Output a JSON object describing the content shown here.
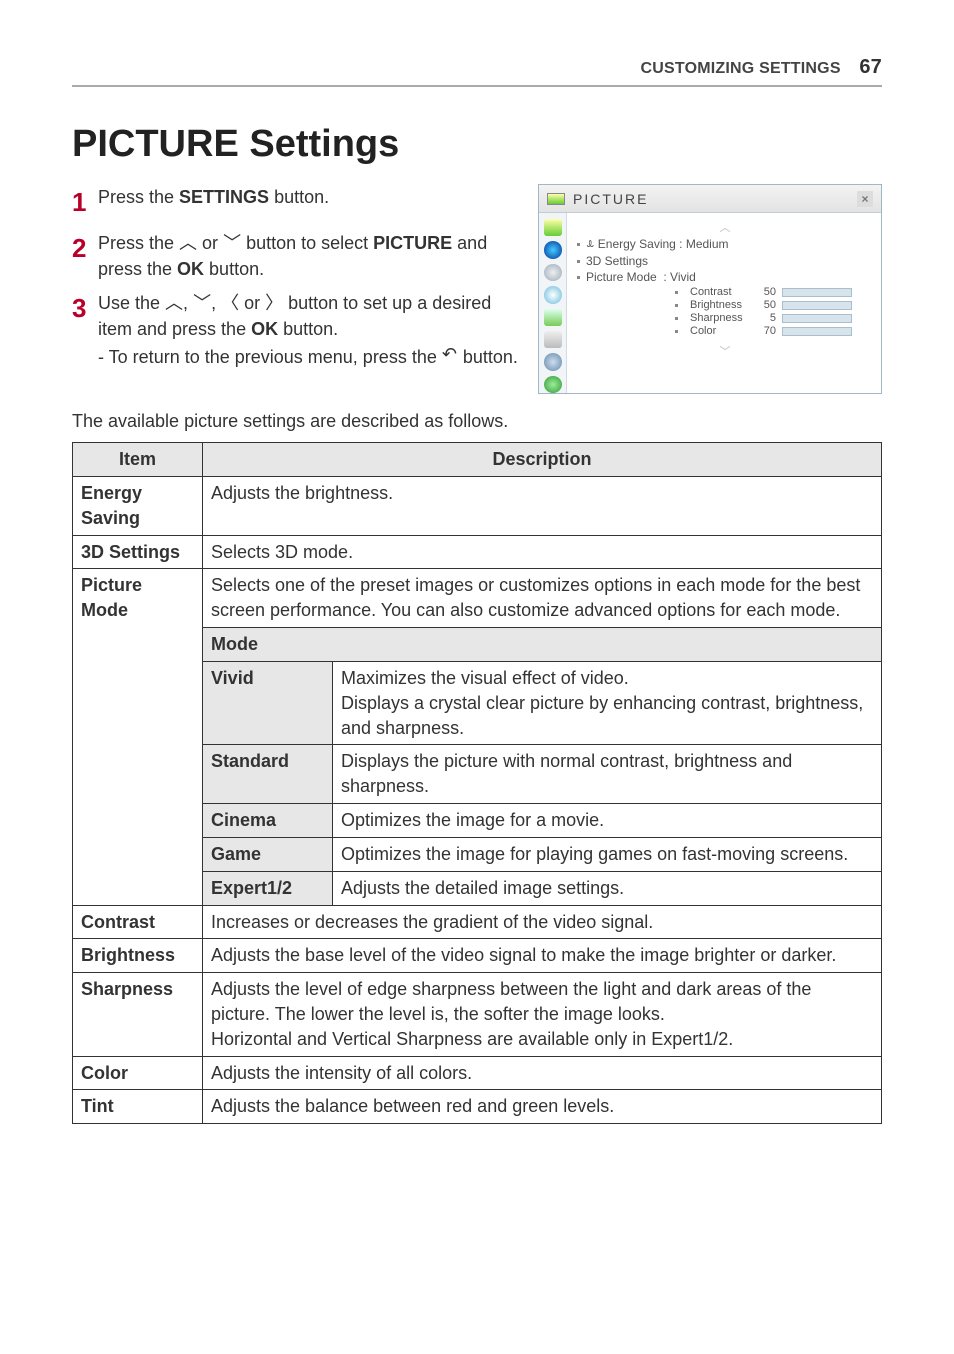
{
  "header": {
    "section": "CUSTOMIZING SETTINGS",
    "page_number": "67"
  },
  "title": "PICTURE Settings",
  "steps": {
    "s1": {
      "num": "1",
      "text_a": "Press the ",
      "bold_a": "SETTINGS",
      "text_b": " button."
    },
    "s2": {
      "num": "2",
      "text_a": "Press the ",
      "text_b": " or ",
      "text_c": " button to select ",
      "bold_a": "PICTURE",
      "text_d": " and press the ",
      "bold_b": "OK",
      "text_e": " button."
    },
    "s3": {
      "num": "3",
      "text_a": "Use the ",
      "text_b": " or ",
      "text_c": " button to set up a desired item and press the ",
      "bold_a": "OK",
      "text_d": " button.",
      "sub_a": "- To return to the previous menu, press the ",
      "sub_b": " button."
    }
  },
  "osd": {
    "title": "PICTURE",
    "lines": {
      "energy": "ꕊ Energy Saving : Medium",
      "threeD": "3D Settings",
      "pmode": "Picture Mode",
      "pmode_value": ": Vivid"
    },
    "sliders": [
      {
        "label": "Contrast",
        "value": "50",
        "fill": 50
      },
      {
        "label": "Brightness",
        "value": "50",
        "fill": 50
      },
      {
        "label": "Sharpness",
        "value": "5",
        "fill": 10
      },
      {
        "label": "Color",
        "value": "70",
        "fill": 70
      }
    ]
  },
  "between": "The available picture settings are described as follows.",
  "table_headers": {
    "item": "Item",
    "desc": "Description"
  },
  "rows": {
    "energy": {
      "name": "Energy Saving",
      "desc": "Adjusts the brightness."
    },
    "threeD": {
      "name": "3D Settings",
      "desc": "Selects 3D mode."
    },
    "pmode": {
      "name": "Picture Mode",
      "desc": "Selects one of the preset images or customizes options in each mode for the best screen performance. You can also customize advanced options for each mode."
    },
    "mode_header": "Mode",
    "modes": {
      "vivid": {
        "name": "Vivid",
        "desc": "Maximizes the visual effect of video.\nDisplays a crystal clear picture by enhancing contrast, brightness, and sharpness."
      },
      "standard": {
        "name": "Standard",
        "desc": "Displays the picture with normal contrast, brightness and sharpness."
      },
      "cinema": {
        "name": "Cinema",
        "desc": "Optimizes the image for a movie."
      },
      "game": {
        "name": "Game",
        "desc": "Optimizes the image for playing games on fast-moving screens."
      },
      "expert": {
        "name": "Expert1/2",
        "desc": "Adjusts the detailed image settings."
      }
    },
    "contrast": {
      "name": "Contrast",
      "desc": "Increases or decreases the gradient of the video signal."
    },
    "brightness": {
      "name": "Brightness",
      "desc": "Adjusts the base level of the video signal to make the image brighter or darker."
    },
    "sharpness": {
      "name": "Sharpness",
      "desc": "Adjusts the level of edge sharpness between the light and dark areas of the picture. The lower the level is, the softer the image looks.\nHorizontal and Vertical Sharpness are available only in Expert1/2."
    },
    "color": {
      "name": "Color",
      "desc": "Adjusts the intensity of all colors."
    },
    "tint": {
      "name": "Tint",
      "desc": "Adjusts the balance between red and green levels."
    }
  }
}
